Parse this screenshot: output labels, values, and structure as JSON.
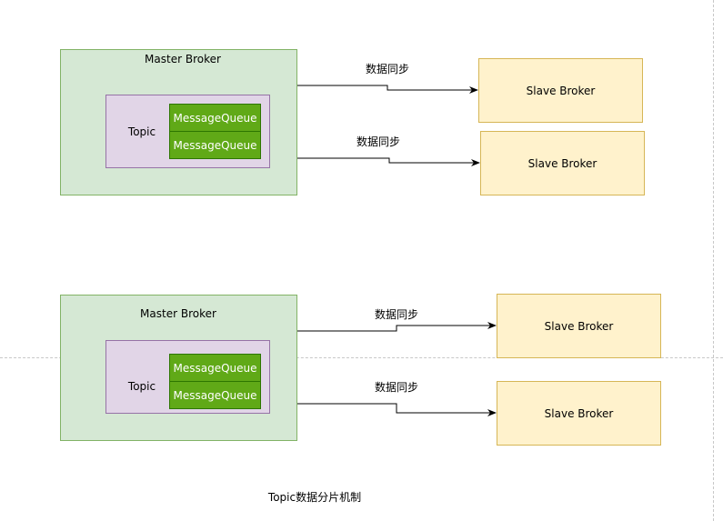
{
  "groups": [
    {
      "master_label": "Master Broker",
      "topic_label": "Topic",
      "queues": [
        "MessageQueue",
        "MessageQueue"
      ],
      "slaves": [
        "Slave Broker",
        "Slave Broker"
      ],
      "sync_labels": [
        "数据同步",
        "数据同步"
      ]
    },
    {
      "master_label": "Master Broker",
      "topic_label": "Topic",
      "queues": [
        "MessageQueue",
        "MessageQueue"
      ],
      "slaves": [
        "Slave Broker",
        "Slave Broker"
      ],
      "sync_labels": [
        "数据同步",
        "数据同步"
      ]
    }
  ],
  "caption": "Topic数据分片机制"
}
